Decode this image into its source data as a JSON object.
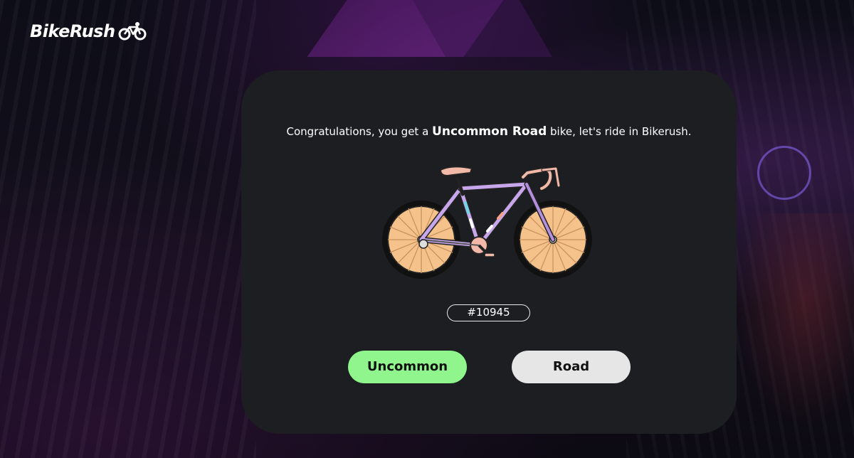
{
  "brand": {
    "name": "BikeRush",
    "icon": "bicycle-icon"
  },
  "reveal": {
    "message_prefix": "Congratulations, you get a ",
    "highlight": "Uncommon Road",
    "message_suffix": " bike, let's ride in Bikerush.",
    "token_id": "#10945",
    "rarity_label": "Uncommon",
    "type_label": "Road"
  },
  "colors": {
    "card": "#1d1e21",
    "rarity_button": "#8ff58c",
    "type_button": "#e6e6e6",
    "bike_frame": "#c8a6ec",
    "wheel_fill": "#f6c28b"
  }
}
